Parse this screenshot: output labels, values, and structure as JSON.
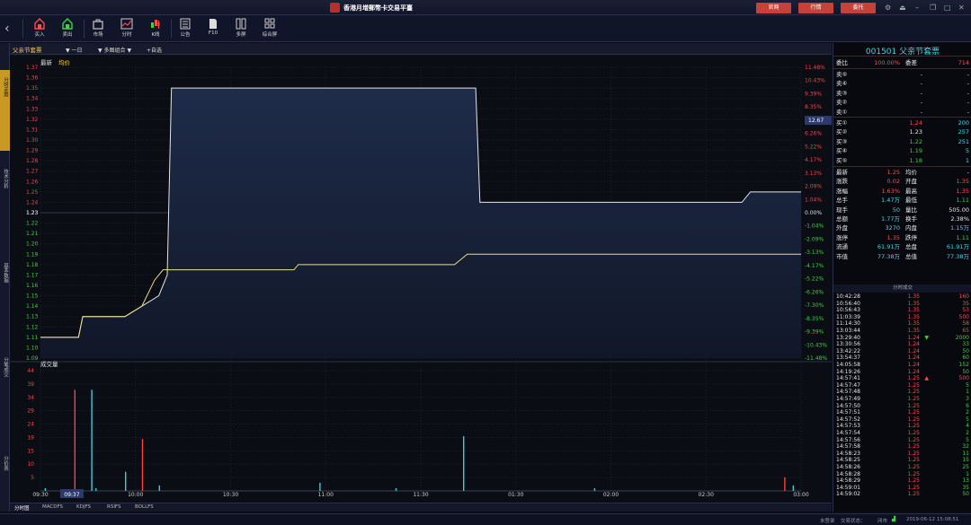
{
  "window": {
    "title": "香港月增郵幣卡交易平臺",
    "btn_official": "官网",
    "btn_market": "行情",
    "btn_trade": "委托"
  },
  "toolbar": {
    "items": [
      "买入",
      "卖出",
      "市场",
      "分时",
      "K线",
      "公告",
      "F10",
      "多屏",
      "综合屏"
    ]
  },
  "sidebar": {
    "items": [
      "分时走势",
      "技术分析",
      "基本数据",
      "分笔成交",
      "分价表"
    ]
  },
  "chart_head": {
    "stock_tab": "父亲节套票",
    "period": "一日",
    "overlay": "多图组合",
    "add_watch": "+自选"
  },
  "chart_data": [
    {
      "type": "line",
      "legend": [
        "最新",
        "均价"
      ],
      "x_ticks": [
        "09:30",
        "10:00",
        "10:30",
        "11:00",
        "11:30",
        "01:30",
        "02:00",
        "02:30",
        "03:00"
      ],
      "x_highlight": "09:37",
      "ylim": [
        1.09,
        1.37
      ],
      "y_ticks": [
        "1.37",
        "1.36",
        "1.35",
        "1.34",
        "1.33",
        "1.32",
        "1.31",
        "1.30",
        "1.29",
        "1.28",
        "1.27",
        "1.26",
        "1.25",
        "1.24",
        "1.23",
        "1.22",
        "1.21",
        "1.20",
        "1.19",
        "1.18",
        "1.17",
        "1.16",
        "1.15",
        "1.14",
        "1.13",
        "1.12",
        "1.11",
        "1.10",
        "1.09"
      ],
      "pct_ticks": [
        "11.48%",
        "10.43%",
        "9.39%",
        "8.35%",
        "7.30%",
        "6.26%",
        "5.22%",
        "4.17%",
        "3.13%",
        "2.09%",
        "1.04%",
        "0.00%",
        "-1.04%",
        "-2.09%",
        "-3.13%",
        "-4.17%",
        "-5.22%",
        "-6.26%",
        "-7.30%",
        "-8.35%",
        "-9.39%",
        "-10.43%",
        "-11.48%"
      ],
      "prev_close": "1.23",
      "cursor_value": "12.67",
      "series": [
        {
          "name": "最新",
          "points": [
            [
              0,
              1.11
            ],
            [
              6,
              1.11
            ],
            [
              9,
              1.11
            ],
            [
              10,
              1.13
            ],
            [
              20,
              1.13
            ],
            [
              24,
              1.14
            ],
            [
              28,
              1.15
            ],
            [
              29,
              1.16
            ],
            [
              30,
              1.17
            ],
            [
              31,
              1.35
            ],
            [
              102,
              1.35
            ],
            [
              103,
              1.35
            ],
            [
              104,
              1.24
            ],
            [
              108,
              1.24
            ],
            [
              160,
              1.24
            ],
            [
              165,
              1.24
            ],
            [
              166,
              1.24
            ],
            [
              168,
              1.25
            ],
            [
              180,
              1.25
            ]
          ]
        },
        {
          "name": "均价",
          "points": [
            [
              0,
              1.11
            ],
            [
              9,
              1.11
            ],
            [
              10,
              1.13
            ],
            [
              20,
              1.13
            ],
            [
              24,
              1.14
            ],
            [
              27,
              1.165
            ],
            [
              29,
              1.175
            ],
            [
              31,
              1.175
            ],
            [
              60,
              1.175
            ],
            [
              61,
              1.18
            ],
            [
              98,
              1.18
            ],
            [
              101,
              1.19
            ],
            [
              135,
              1.19
            ],
            [
              180,
              1.19
            ]
          ]
        }
      ]
    },
    {
      "type": "bar",
      "title": "成交量",
      "ylim": [
        0,
        44
      ],
      "y_ticks": [
        "44",
        "39",
        "34",
        "29",
        "24",
        "19",
        "15",
        "10",
        "5"
      ],
      "bars": [
        {
          "x": 1,
          "v": 1,
          "c": "#42c8d8"
        },
        {
          "x": 8,
          "v": 37,
          "c": "#ff4040"
        },
        {
          "x": 13,
          "v": 1,
          "c": "#42c8d8"
        },
        {
          "x": 12,
          "v": 37,
          "c": "#42c8d8"
        },
        {
          "x": 20,
          "v": 7,
          "c": "#42c8d8"
        },
        {
          "x": 24,
          "v": 19,
          "c": "#ff4040"
        },
        {
          "x": 28,
          "v": 2,
          "c": "#42c8d8"
        },
        {
          "x": 66,
          "v": 3,
          "c": "#42c8d8"
        },
        {
          "x": 84,
          "v": 1,
          "c": "#42c8d8"
        },
        {
          "x": 100,
          "v": 20,
          "c": "#42c8d8"
        },
        {
          "x": 131,
          "v": 1,
          "c": "#42c8d8"
        },
        {
          "x": 176,
          "v": 5,
          "c": "#ff4040"
        },
        {
          "x": 178,
          "v": 2,
          "c": "#42c8d8"
        }
      ]
    }
  ],
  "bottom_tabs": [
    "分时图",
    "MACDFS",
    "KDJFS",
    "RSIFS",
    "BOLLFS"
  ],
  "status": {
    "left": "未登录",
    "state": "交易状态：",
    "closed": "闭市",
    "time": "2019-06-12 15:08:51"
  },
  "quote": {
    "code": "001501",
    "name": "父亲节套票",
    "weibi_label": "委比",
    "weibi": "100.00%",
    "weicha_label": "委差",
    "weicha": "714",
    "asks": [
      {
        "l": "卖⑤",
        "p": "-",
        "v": "-"
      },
      {
        "l": "卖④",
        "p": "-",
        "v": "-"
      },
      {
        "l": "卖③",
        "p": "-",
        "v": "-"
      },
      {
        "l": "卖②",
        "p": "-",
        "v": "-"
      },
      {
        "l": "卖①",
        "p": "-",
        "v": "-"
      }
    ],
    "bids": [
      {
        "l": "买①",
        "p": "1.24",
        "v": "200"
      },
      {
        "l": "买②",
        "p": "1.23",
        "v": "257"
      },
      {
        "l": "买③",
        "p": "1.22",
        "v": "251"
      },
      {
        "l": "买④",
        "p": "1.19",
        "v": "5"
      },
      {
        "l": "买⑤",
        "p": "1.18",
        "v": "1"
      }
    ],
    "stats": [
      {
        "a": "最新",
        "b": "1.25",
        "c": "均价",
        "d": "-"
      },
      {
        "a": "涨跌",
        "b": "0.02",
        "c": "开盘",
        "d": "1.35"
      },
      {
        "a": "涨幅",
        "b": "1.63%",
        "c": "最高",
        "d": "1.35"
      },
      {
        "a": "总手",
        "b": "1.47万",
        "c": "最低",
        "d": "1.11"
      },
      {
        "a": "现手",
        "b": "50",
        "c": "量比",
        "d": "505.00"
      },
      {
        "a": "总额",
        "b": "1.77万",
        "c": "换手",
        "d": "2.38%"
      },
      {
        "a": "外盘",
        "b": "3270",
        "c": "内盘",
        "d": "1.15万"
      },
      {
        "a": "涨停",
        "b": "1.35",
        "c": "跌停",
        "d": "1.11"
      },
      {
        "a": "流通",
        "b": "61.91万",
        "c": "总盘",
        "d": "61.91万"
      },
      {
        "a": "市值",
        "b": "77.38万",
        "c": "总值",
        "d": "77.38万"
      }
    ],
    "ticks_title": "分时成交",
    "ticks": [
      {
        "t": "10:42:28",
        "p": "1.35",
        "v": "160",
        "c": "red"
      },
      {
        "t": "10:56:40",
        "p": "1.35",
        "v": "35",
        "c": "red"
      },
      {
        "t": "10:56:43",
        "p": "1.35",
        "v": "53",
        "c": "red"
      },
      {
        "t": "11:03:39",
        "p": "1.35",
        "v": "500",
        "c": "red"
      },
      {
        "t": "11:14:30",
        "p": "1.35",
        "v": "58",
        "c": "red"
      },
      {
        "t": "13:03:44",
        "p": "1.35",
        "v": "65",
        "c": "red"
      },
      {
        "t": "13:29:40",
        "p": "1.24",
        "v": "2000",
        "c": "grn",
        "m": "▼"
      },
      {
        "t": "13:30:56",
        "p": "1.24",
        "v": "33",
        "c": "grn"
      },
      {
        "t": "13:42:22",
        "p": "1.24",
        "v": "50",
        "c": "grn"
      },
      {
        "t": "13:54:37",
        "p": "1.24",
        "v": "60",
        "c": "grn"
      },
      {
        "t": "14:05:58",
        "p": "1.24",
        "v": "152",
        "c": "grn"
      },
      {
        "t": "14:19:26",
        "p": "1.24",
        "v": "50",
        "c": "grn"
      },
      {
        "t": "14:57:41",
        "p": "1.25",
        "v": "500",
        "c": "red",
        "m": "▲"
      },
      {
        "t": "14:57:47",
        "p": "1.25",
        "v": "5",
        "c": "grn"
      },
      {
        "t": "14:57:48",
        "p": "1.25",
        "v": "1",
        "c": "grn"
      },
      {
        "t": "14:57:49",
        "p": "1.25",
        "v": "3",
        "c": "grn"
      },
      {
        "t": "14:57:50",
        "p": "1.25",
        "v": "6",
        "c": "grn"
      },
      {
        "t": "14:57:51",
        "p": "1.25",
        "v": "2",
        "c": "grn"
      },
      {
        "t": "14:57:52",
        "p": "1.25",
        "v": "5",
        "c": "grn"
      },
      {
        "t": "14:57:53",
        "p": "1.25",
        "v": "4",
        "c": "grn"
      },
      {
        "t": "14:57:54",
        "p": "1.25",
        "v": "2",
        "c": "grn"
      },
      {
        "t": "14:57:56",
        "p": "1.25",
        "v": "5",
        "c": "grn"
      },
      {
        "t": "14:57:58",
        "p": "1.25",
        "v": "32",
        "c": "grn"
      },
      {
        "t": "14:58:23",
        "p": "1.25",
        "v": "11",
        "c": "grn"
      },
      {
        "t": "14:58:25",
        "p": "1.25",
        "v": "15",
        "c": "grn"
      },
      {
        "t": "14:58:26",
        "p": "1.25",
        "v": "25",
        "c": "grn"
      },
      {
        "t": "14:58:28",
        "p": "1.25",
        "v": "1",
        "c": "grn"
      },
      {
        "t": "14:58:29",
        "p": "1.25",
        "v": "13",
        "c": "grn"
      },
      {
        "t": "14:59:01",
        "p": "1.25",
        "v": "35",
        "c": "grn"
      },
      {
        "t": "14:59:02",
        "p": "1.25",
        "v": "50",
        "c": "grn"
      }
    ]
  }
}
